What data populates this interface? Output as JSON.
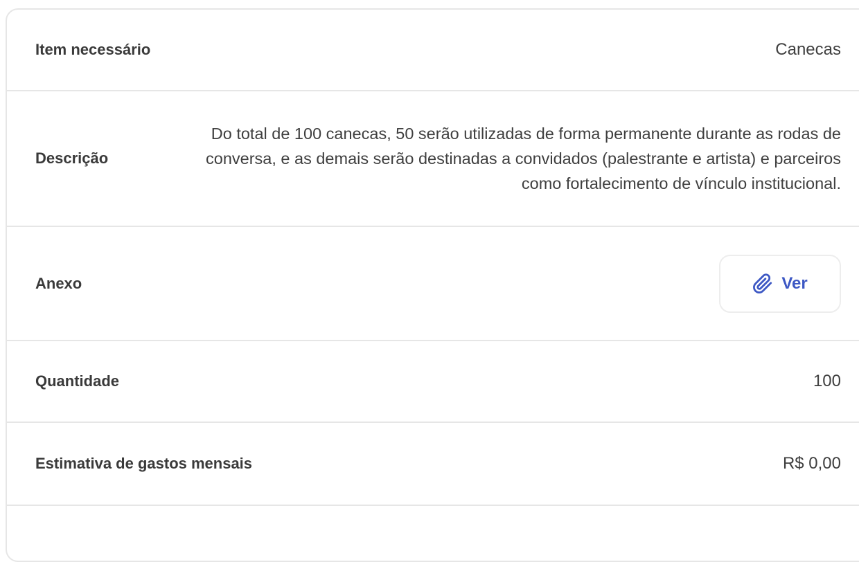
{
  "rows": {
    "item": {
      "label": "Item necessário",
      "value": "Canecas"
    },
    "description": {
      "label": "Descrição",
      "value": "Do total de 100 canecas, 50 serão utilizadas de forma permanente durante as rodas de conversa, e as demais serão destinadas a convidados (palestrante e artista) e parceiros como fortalecimento de vínculo institucional."
    },
    "attachment": {
      "label": "Anexo",
      "button_label": "Ver",
      "button_icon": "paperclip-icon"
    },
    "quantity": {
      "label": "Quantidade",
      "value": "100"
    },
    "estimate": {
      "label": "Estimativa de gastos mensais",
      "value": "R$ 0,00"
    }
  },
  "colors": {
    "accent": "#3d58c4",
    "border": "#e6e6e6",
    "text": "#3b3b3b"
  }
}
